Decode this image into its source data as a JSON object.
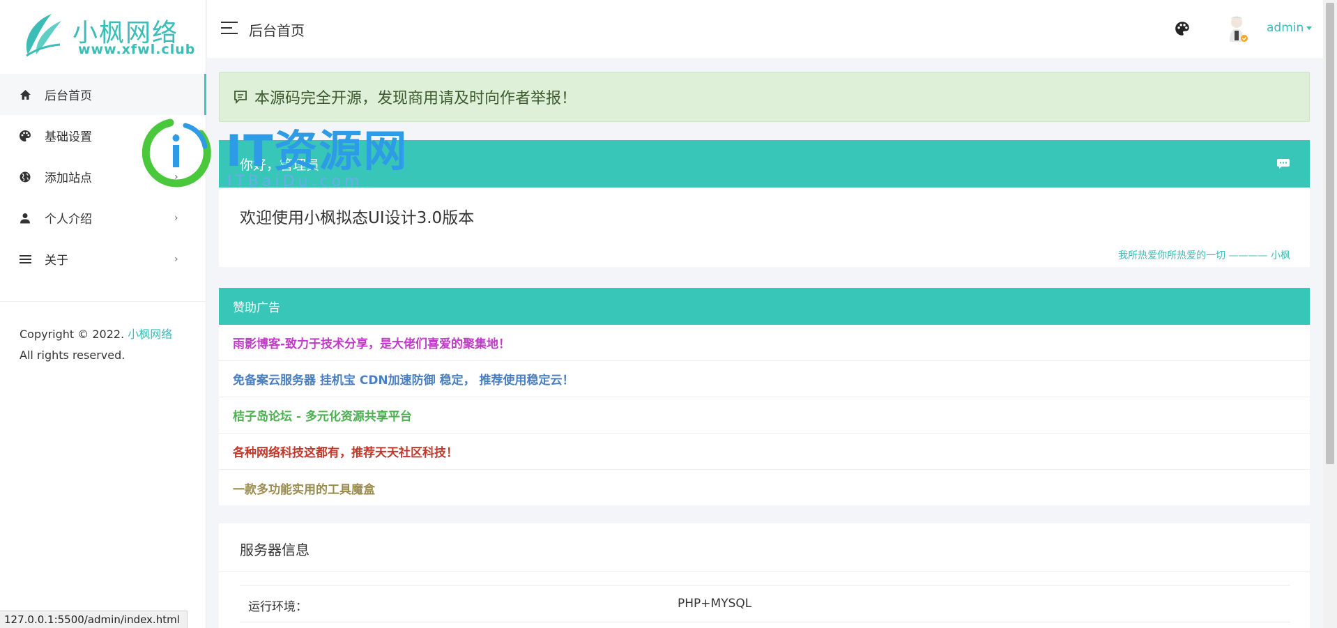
{
  "brand": {
    "name": "小枫网络",
    "url": "www.xfwl.club"
  },
  "sidebar": {
    "items": [
      {
        "label": "后台首页",
        "icon": "home-icon",
        "active": true
      },
      {
        "label": "基础设置",
        "icon": "palette-icon",
        "has_arrow": true
      },
      {
        "label": "添加站点",
        "icon": "globe-icon",
        "has_arrow": true
      },
      {
        "label": "个人介绍",
        "icon": "user-icon",
        "has_arrow": true
      },
      {
        "label": "关于",
        "icon": "list-icon",
        "has_arrow": true
      }
    ],
    "copyright_prefix": "Copyright © 2022.",
    "copyright_brand": "小枫网络",
    "copyright_suffix": "All rights reserved."
  },
  "header": {
    "title": "后台首页",
    "user": "admin"
  },
  "notice": {
    "text": "本源码完全开源，发现商用请及时向作者举报！"
  },
  "welcome": {
    "head": "你好，管理员",
    "body": "欢迎使用小枫拟态UI设计3.0版本",
    "sign": "我所热爱你所热爱的一切 ———— 小枫"
  },
  "ads": {
    "title": "赞助广告",
    "items": [
      {
        "text": "雨影博客-致力于技术分享，是大佬们喜爱的聚集地！",
        "color": "#c13bc8"
      },
      {
        "text": "免备案云服务器 挂机宝 CDN加速防御 稳定， 推荐使用稳定云！",
        "color": "#4a7fc1"
      },
      {
        "text": "桔子岛论坛 - 多元化资源共享平台",
        "color": "#4caf50"
      },
      {
        "text": "各种网络科技这都有，推荐天天社区科技！",
        "color": "#c0392b"
      },
      {
        "text": "一款多功能实用的工具魔盒",
        "color": "#9a8c4e"
      }
    ]
  },
  "server": {
    "title": "服务器信息",
    "rows": [
      {
        "label": "运行环境：",
        "value": "PHP+MYSQL"
      }
    ]
  },
  "watermark": {
    "title": "IT资源网",
    "sub": "ITBaiDu.com"
  },
  "status_url": "127.0.0.1:5500/admin/index.html",
  "colors": {
    "accent": "#38c6b8",
    "notice_bg": "#dff0d8",
    "brand": "#3cbcb6"
  }
}
